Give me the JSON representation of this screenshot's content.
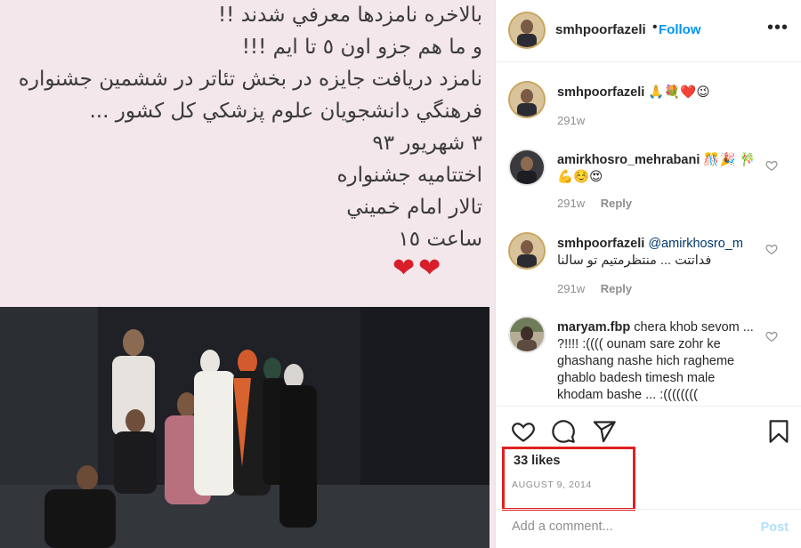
{
  "media": {
    "caption_lines": [
      "بالاخره نامزدها معرفي شدند !!",
      "و ما هم جزو اون ٥ تا ايم !!!",
      "نامزد دريافت جايزه در بخش تئاتر در ششمين جشنواره",
      "فرهنگي دانشجويان علوم پزشكي كل كشور ...",
      "٣ شهريور ٩٣",
      "اختتاميه جشنواره",
      "تالار امام خميني",
      "ساعت ١٥"
    ],
    "hearts": "❤❤"
  },
  "header": {
    "username": "smhpoorfazeli",
    "dot": "•",
    "follow_label": "Follow",
    "more_icon": "more-horizontal-icon",
    "more_glyph": "•••"
  },
  "comments": [
    {
      "username": "smhpoorfazeli",
      "text": " 🙏💐❤️😉",
      "time": "291w",
      "reply_label": ""
    },
    {
      "username": "amirkhosro_mehrabani",
      "text": " 🎊🎉 🎋💪☺️😍",
      "time": "291w",
      "reply_label": "Reply"
    },
    {
      "username": "smhpoorfazeli",
      "mention": "@amirkhosro_m",
      "text": "فداتتت ... منتظرمتیم تو سالنا",
      "time": "291w",
      "reply_label": "Reply"
    },
    {
      "username": "maryam.fbp",
      "text": " chera khob sevom ... ?!!!! :(((( ounam sare zohr ke ghashang nashe hich ragheme ghablo badesh timesh male khodam bashe ... :((((((((",
      "time": "",
      "reply_label": ""
    }
  ],
  "actions": {
    "like_icon": "heart-icon",
    "comment_icon": "comment-icon",
    "share_icon": "share-icon",
    "save_icon": "bookmark-icon"
  },
  "likes": "33 likes",
  "date": "AUGUST 9, 2014",
  "add_comment": {
    "placeholder": "Add a comment...",
    "post_label": "Post"
  },
  "colors": {
    "accent": "#0095f6",
    "post_disabled": "#b2dffc",
    "highlight_box": "#e02020",
    "heart_red": "#d81e2a"
  }
}
